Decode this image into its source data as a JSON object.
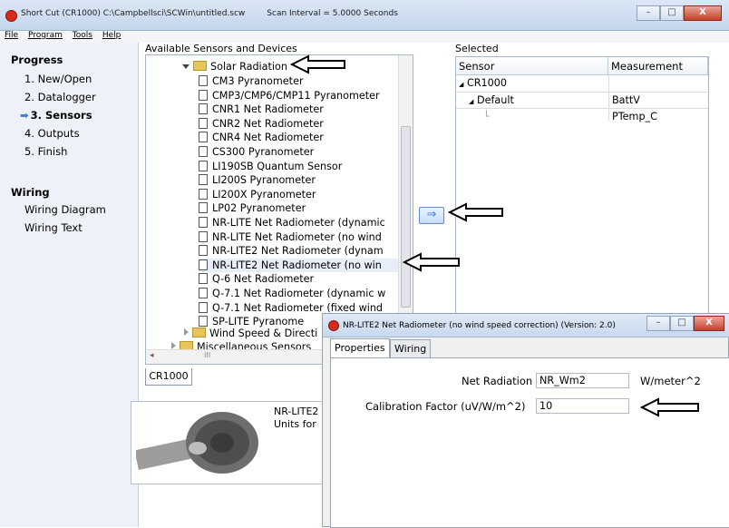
{
  "window": {
    "title": "Short Cut (CR1000) C:\\Campbellsci\\SCWin\\untitled.scw",
    "scan_interval": "Scan Interval = 5.0000 Seconds",
    "min": "–",
    "max": "□",
    "close": "X"
  },
  "menu": [
    "File",
    "Program",
    "Tools",
    "Help"
  ],
  "progress": {
    "heading": "Progress",
    "steps": [
      "1. New/Open",
      "2. Datalogger",
      "3. Sensors",
      "4. Outputs",
      "5. Finish"
    ]
  },
  "wiring": {
    "heading": "Wiring",
    "items": [
      "Wiring Diagram",
      "Wiring Text"
    ]
  },
  "available": {
    "label": "Available Sensors and Devices",
    "folder": "Solar Radiation",
    "sensors": [
      "CM3 Pyranometer",
      "CMP3/CMP6/CMP11 Pyranometer",
      "CNR1 Net Radiometer",
      "CNR2 Net Radiometer",
      "CNR4 Net Radiometer",
      "CS300 Pyranometer",
      "LI190SB Quantum Sensor",
      "LI200S Pyranometer",
      "LI200X Pyranometer",
      "LP02 Pyranometer",
      "NR-LITE Net Radiometer (dynamic",
      "NR-LITE Net Radiometer (no wind",
      "NR-LITE2 Net Radiometer (dynam",
      "NR-LITE2 Net Radiometer (no win",
      "Q-6 Net Radiometer",
      "Q-7.1 Net Radiometer (dynamic w",
      "Q-7.1 Net Radiometer (fixed wind",
      "SP-LITE Pyranome"
    ],
    "folders_after": [
      "Wind Speed & Directi",
      "Miscellaneous Sensors"
    ],
    "scroll_glyph": "III",
    "tab": "CR1000"
  },
  "description": {
    "line1": "NR-LITE2",
    "line2": "Units for"
  },
  "add_button": "⇒",
  "selected": {
    "label": "Selected",
    "col_sensor": "Sensor",
    "col_measurement": "Measurement",
    "rows": [
      {
        "sensor": "CR1000",
        "measurement": ""
      },
      {
        "sensor": "Default",
        "measurement": "BattV"
      },
      {
        "sensor": "",
        "measurement": "PTemp_C"
      }
    ]
  },
  "dialog": {
    "title": "NR-LITE2 Net Radiometer (no wind speed correction) (Version: 2.0)",
    "tabs": [
      "Properties",
      "Wiring"
    ],
    "net_radiation_label": "Net Radiation",
    "net_radiation_value": "NR_Wm2",
    "net_radiation_unit": "W/meter^2",
    "cal_label": "Calibration Factor (uV/W/m^2)",
    "cal_value": "10",
    "min": "–",
    "max": "□",
    "close": "X"
  },
  "colors": {
    "accent": "#3c7fd0",
    "close": "#c7402b",
    "folder": "#e7c55a"
  }
}
